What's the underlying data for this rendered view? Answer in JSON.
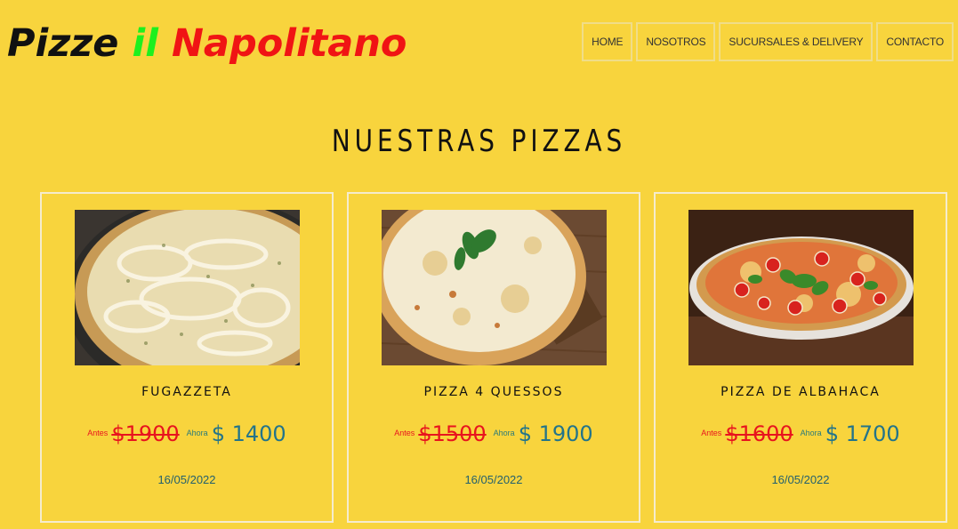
{
  "header": {
    "logo": {
      "word1": "Pizze",
      "word2": "il",
      "word3": "Napolitano"
    },
    "nav": [
      {
        "label": "HOME"
      },
      {
        "label": "NOSOTROS"
      },
      {
        "label": "SUCURSALES & DELIVERY"
      },
      {
        "label": "CONTACTO"
      }
    ]
  },
  "main": {
    "title": "NUESTRAS PIZZAS",
    "cards": [
      {
        "name": "FUGAZZETA",
        "before_label": "Antes",
        "old_price": "$1900",
        "now_label": "Ahora",
        "new_price": "$ 1400",
        "date": "16/05/2022"
      },
      {
        "name": "PIZZA 4 QUESSOS",
        "before_label": "Antes",
        "old_price": "$1500",
        "now_label": "Ahora",
        "new_price": "$ 1900",
        "date": "16/05/2022"
      },
      {
        "name": "PIZZA DE ALBAHACA",
        "before_label": "Antes",
        "old_price": "$1600",
        "now_label": "Ahora",
        "new_price": "$ 1700",
        "date": "16/05/2022"
      }
    ]
  },
  "colors": {
    "background": "#f8d43d",
    "logo_black": "#111111",
    "logo_green": "#1ef01e",
    "logo_red": "#f01414",
    "price_old": "#e8141e",
    "price_new": "#23748a"
  }
}
